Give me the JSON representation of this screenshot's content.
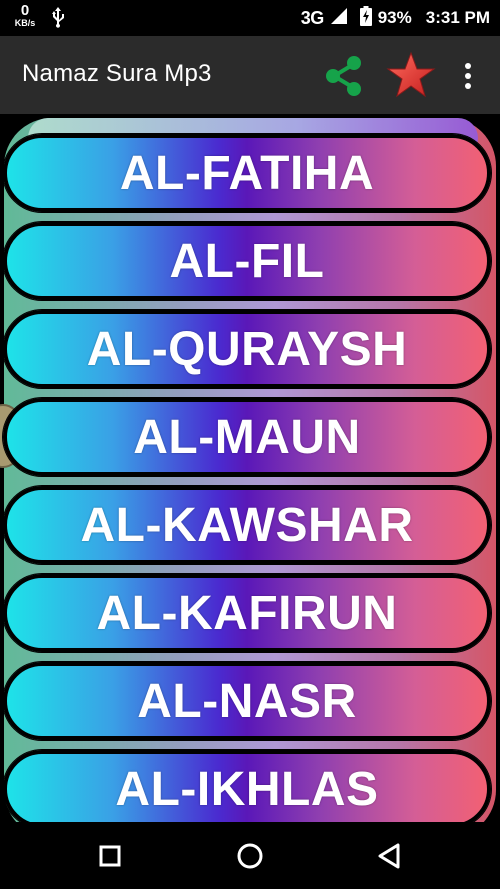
{
  "status_bar": {
    "speed_value": "0",
    "speed_unit": "KB/s",
    "network": "3G",
    "battery": "93%",
    "time": "3:31 PM",
    "icons": [
      "usb-icon",
      "signal-icon",
      "battery-charging-icon"
    ]
  },
  "app_bar": {
    "title": "Namaz Sura Mp3",
    "share_icon_color": "#16a34a",
    "star_icon_color": "#e53935",
    "icons": [
      "share-icon",
      "star-icon",
      "overflow-menu-icon"
    ]
  },
  "suras": [
    {
      "label": "AL-FATIHA"
    },
    {
      "label": "AL-FIL"
    },
    {
      "label": "AL-QURAYSH"
    },
    {
      "label": "AL-MAUN"
    },
    {
      "label": "AL-KAWSHAR"
    },
    {
      "label": "AL-KAFIRUN"
    },
    {
      "label": "AL-NASR"
    },
    {
      "label": "AL-IKHLAS"
    }
  ],
  "nav_bar": {
    "icons": [
      "recents-square-icon",
      "home-circle-icon",
      "back-triangle-icon"
    ]
  },
  "colors": {
    "button_gradient_start": "#1ee3e8",
    "button_gradient_mid": "#5a18b8",
    "button_gradient_end": "#f26073",
    "app_bar_bg": "#2b2b2b"
  }
}
